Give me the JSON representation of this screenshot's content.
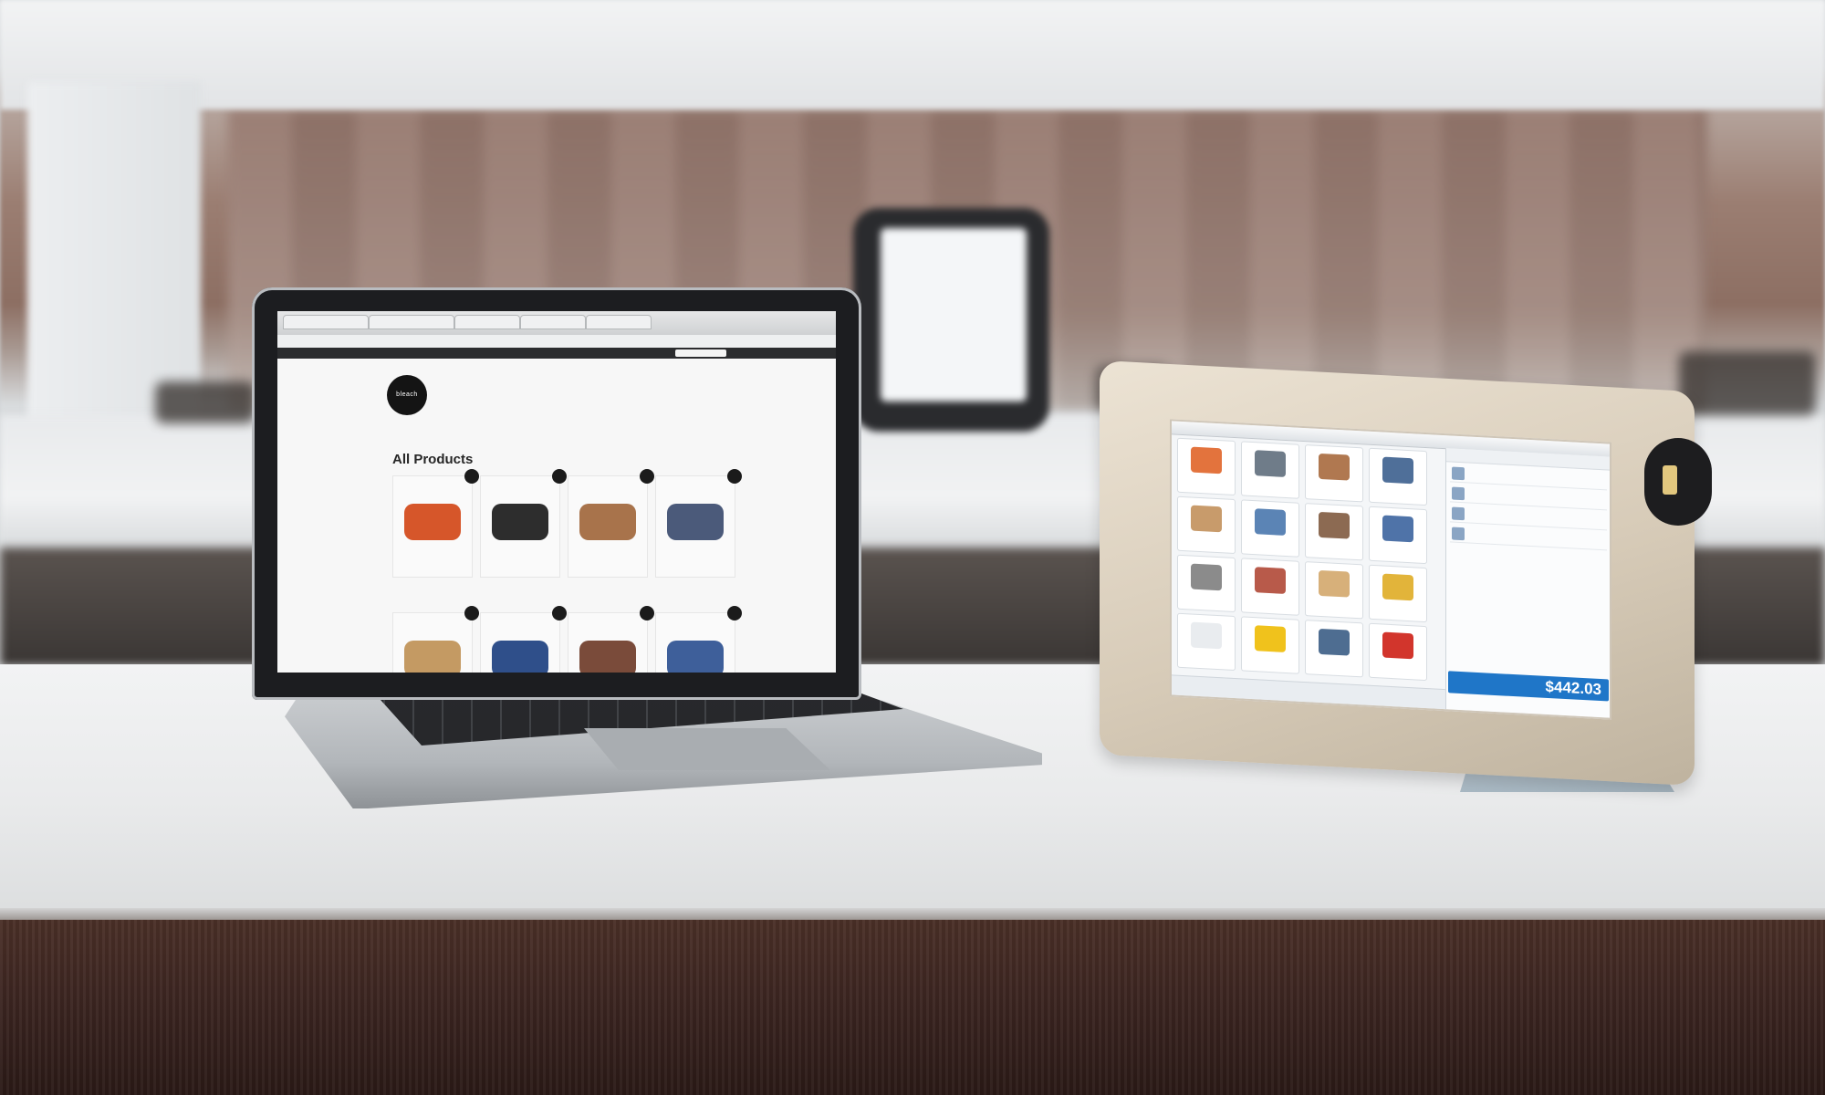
{
  "laptop": {
    "browser_tabs": [
      "",
      "",
      "",
      "",
      ""
    ],
    "address": "",
    "site_nav_label": "",
    "logo_text": "bleach",
    "site_menu": [
      "",
      "",
      "",
      ""
    ],
    "breadcrumb": "",
    "sort_label": "",
    "page_heading": "All Products",
    "products": [
      {
        "name": "",
        "price": "",
        "sub": "",
        "color": "#d6562a"
      },
      {
        "name": "",
        "price": "",
        "sub": "",
        "color": "#2d2d2d"
      },
      {
        "name": "",
        "price": "",
        "sub": "",
        "color": "#a8734b"
      },
      {
        "name": "",
        "price": "",
        "sub": "",
        "color": "#4b5a7a"
      },
      {
        "name": "",
        "price": "",
        "sub": "",
        "color": "#c49a63"
      },
      {
        "name": "",
        "price": "",
        "sub": "",
        "color": "#2f4f8a"
      },
      {
        "name": "",
        "price": "",
        "sub": "",
        "color": "#7a4b3a"
      },
      {
        "name": "",
        "price": "",
        "sub": "",
        "color": "#3e5f9a"
      }
    ]
  },
  "pos": {
    "topbar_label": "",
    "panel_header": "",
    "tiles": [
      {
        "label": "",
        "color": "#e3733d"
      },
      {
        "label": "",
        "color": "#6f7c89"
      },
      {
        "label": "",
        "color": "#b07850"
      },
      {
        "label": "",
        "color": "#4f6f99"
      },
      {
        "label": "",
        "color": "#c89b6b"
      },
      {
        "label": "",
        "color": "#5b84b5"
      },
      {
        "label": "",
        "color": "#8c6a52"
      },
      {
        "label": "",
        "color": "#4f73a8"
      },
      {
        "label": "",
        "color": "#8b8b8b"
      },
      {
        "label": "",
        "color": "#b85a4a"
      },
      {
        "label": "",
        "color": "#d7b07a"
      },
      {
        "label": "",
        "color": "#e2b43a"
      },
      {
        "label": "",
        "color": "#e9ecef"
      },
      {
        "label": "",
        "color": "#f0c21c"
      },
      {
        "label": "",
        "color": "#4e6d91"
      },
      {
        "label": "",
        "color": "#d2352c"
      }
    ],
    "line_items": [
      {
        "name": "",
        "price": ""
      },
      {
        "name": "",
        "price": ""
      },
      {
        "name": "",
        "price": ""
      },
      {
        "name": "",
        "price": ""
      }
    ],
    "charge_label": "",
    "charge_amount": "$442.03",
    "accent_color": "#1f76c8"
  }
}
